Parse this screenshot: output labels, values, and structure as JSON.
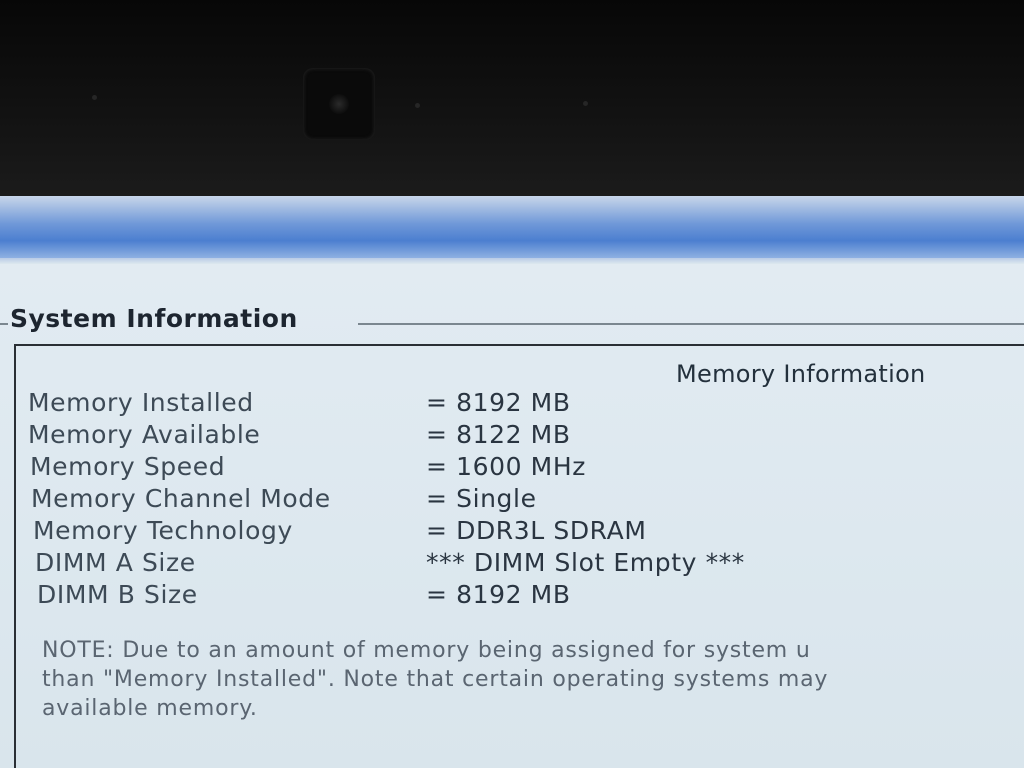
{
  "section": {
    "title": "System Information"
  },
  "panel": {
    "heading": "Memory Information"
  },
  "rows": [
    {
      "label": "Memory Installed",
      "value": "= 8192 MB"
    },
    {
      "label": "Memory Available",
      "value": "= 8122 MB"
    },
    {
      "label": "Memory Speed",
      "value": "= 1600 MHz"
    },
    {
      "label": "Memory Channel Mode",
      "value": "= Single"
    },
    {
      "label": "Memory Technology",
      "value": "= DDR3L SDRAM"
    },
    {
      "label": "DIMM A Size",
      "value": "*** DIMM Slot Empty ***"
    },
    {
      "label": "DIMM B Size",
      "value": "= 8192 MB"
    }
  ],
  "note": {
    "lines": [
      "NOTE: Due to an amount of memory being assigned for system u",
      "than \"Memory Installed\". Note that certain operating systems may",
      "available memory."
    ]
  },
  "colors": {
    "title_bar": "#4c7fd0",
    "screen_background": "#dde8ef",
    "text": "#2a3541"
  }
}
